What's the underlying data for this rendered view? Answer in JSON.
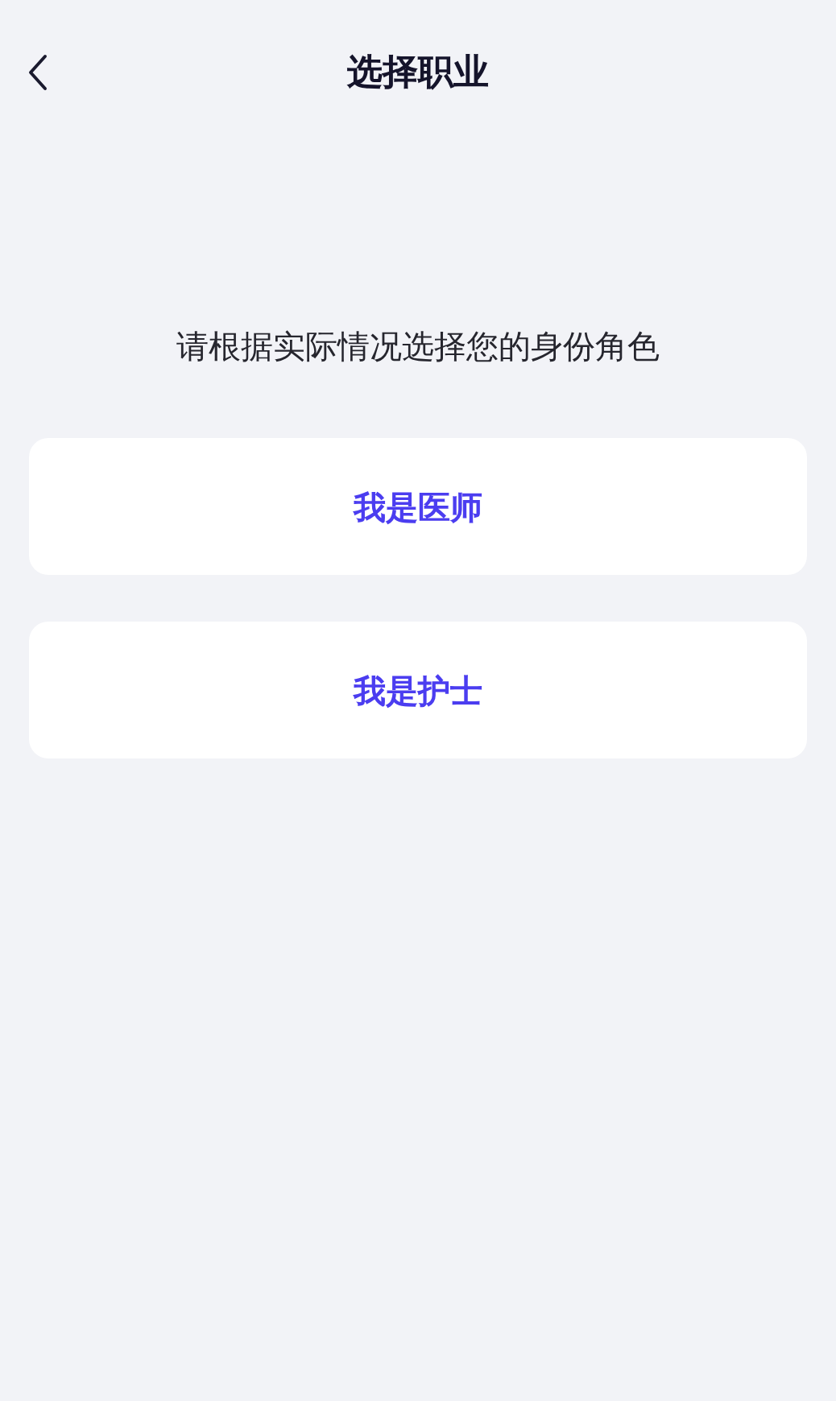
{
  "header": {
    "title": "选择职业"
  },
  "prompt": "请根据实际情况选择您的身份角色",
  "options": [
    {
      "label": "我是医师"
    },
    {
      "label": "我是护士"
    }
  ]
}
